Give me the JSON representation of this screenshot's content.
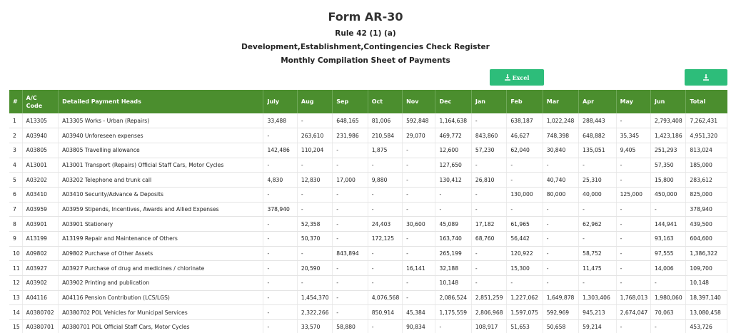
{
  "form": {
    "title": "Form AR-30",
    "rule": "Rule 42 (1) (a)",
    "subtitle1": "Development,Establishment,Contingencies Check Register",
    "subtitle2": "Monthly Compilation Sheet of Payments"
  },
  "toolbar": {
    "excel_label": "Excel",
    "accent_color": "#2dbd7a"
  },
  "table": {
    "header_color": "#4b8e2e",
    "columns": [
      "#",
      "A/C Code",
      "Detailed Payment Heads",
      "July",
      "Aug",
      "Sep",
      "Oct",
      "Nov",
      "Dec",
      "Jan",
      "Feb",
      "Mar",
      "Apr",
      "May",
      "Jun",
      "Total"
    ],
    "rows": [
      [
        "1",
        "A13305",
        "A13305 Works - Urban (Repairs)",
        "33,488",
        "-",
        "648,165",
        "81,006",
        "592,848",
        "1,164,638",
        "-",
        "638,187",
        "1,022,248",
        "288,443",
        "-",
        "2,793,408",
        "7,262,431"
      ],
      [
        "2",
        "A03940",
        "A03940 Unforeseen expenses",
        "-",
        "263,610",
        "231,986",
        "210,584",
        "29,070",
        "469,772",
        "843,860",
        "46,627",
        "748,398",
        "648,882",
        "35,345",
        "1,423,186",
        "4,951,320"
      ],
      [
        "3",
        "A03805",
        "A03805 Travelling allowance",
        "142,486",
        "110,204",
        "-",
        "1,875",
        "-",
        "12,600",
        "57,230",
        "62,040",
        "30,840",
        "135,051",
        "9,405",
        "251,293",
        "813,024"
      ],
      [
        "4",
        "A13001",
        "A13001 Transport (Repairs) Official Staff Cars, Motor Cycles",
        "-",
        "-",
        "-",
        "-",
        "-",
        "127,650",
        "-",
        "-",
        "-",
        "-",
        "-",
        "57,350",
        "185,000"
      ],
      [
        "5",
        "A03202",
        "A03202 Telephone and trunk call",
        "4,830",
        "12,830",
        "17,000",
        "9,880",
        "-",
        "130,412",
        "26,810",
        "-",
        "40,740",
        "25,310",
        "-",
        "15,800",
        "283,612"
      ],
      [
        "6",
        "A03410",
        "A03410 Security/Advance & Deposits",
        "-",
        "-",
        "-",
        "-",
        "-",
        "-",
        "-",
        "130,000",
        "80,000",
        "40,000",
        "125,000",
        "450,000",
        "825,000"
      ],
      [
        "7",
        "A03959",
        "A03959 Stipends, Incentives, Awards and Allied Expenses",
        "378,940",
        "-",
        "-",
        "-",
        "-",
        "-",
        "-",
        "-",
        "-",
        "-",
        "-",
        "-",
        "378,940"
      ],
      [
        "8",
        "A03901",
        "A03901 Stationery",
        "-",
        "52,358",
        "-",
        "24,403",
        "30,600",
        "45,089",
        "17,182",
        "61,965",
        "-",
        "62,962",
        "-",
        "144,941",
        "439,500"
      ],
      [
        "9",
        "A13199",
        "A13199 Repair and Maintenance of Others",
        "-",
        "50,370",
        "-",
        "172,125",
        "-",
        "163,740",
        "68,760",
        "56,442",
        "-",
        "-",
        "-",
        "93,163",
        "604,600"
      ],
      [
        "10",
        "A09802",
        "A09802 Purchase of Other Assets",
        "-",
        "-",
        "843,894",
        "-",
        "-",
        "265,199",
        "-",
        "120,922",
        "-",
        "58,752",
        "-",
        "97,555",
        "1,386,322"
      ],
      [
        "11",
        "A03927",
        "A03927 Purchase of drug and medicines / chlorinate",
        "-",
        "20,590",
        "-",
        "-",
        "16,141",
        "32,188",
        "-",
        "15,300",
        "-",
        "11,475",
        "-",
        "14,006",
        "109,700"
      ],
      [
        "12",
        "A03902",
        "A03902 Printing and publication",
        "-",
        "-",
        "-",
        "-",
        "-",
        "10,148",
        "-",
        "-",
        "-",
        "-",
        "-",
        "-",
        "10,148"
      ],
      [
        "13",
        "A04116",
        "A04116 Pension Contribution (LCS/LGS)",
        "-",
        "1,454,370",
        "-",
        "4,076,568",
        "-",
        "2,086,524",
        "2,851,259",
        "1,227,062",
        "1,649,878",
        "1,303,406",
        "1,768,013",
        "1,980,060",
        "18,397,140"
      ],
      [
        "14",
        "A0380702",
        "A0380702 POL Vehicles for Municipal Services",
        "-",
        "2,322,266",
        "-",
        "850,914",
        "45,384",
        "1,175,559",
        "2,806,968",
        "1,597,075",
        "592,969",
        "945,213",
        "2,674,047",
        "70,063",
        "13,080,458"
      ],
      [
        "15",
        "A0380701",
        "A0380701 POL Official Staff Cars, Motor Cycles",
        "-",
        "33,570",
        "58,880",
        "-",
        "90,834",
        "-",
        "108,917",
        "51,653",
        "50,658",
        "59,214",
        "-",
        "-",
        "453,726"
      ]
    ]
  }
}
